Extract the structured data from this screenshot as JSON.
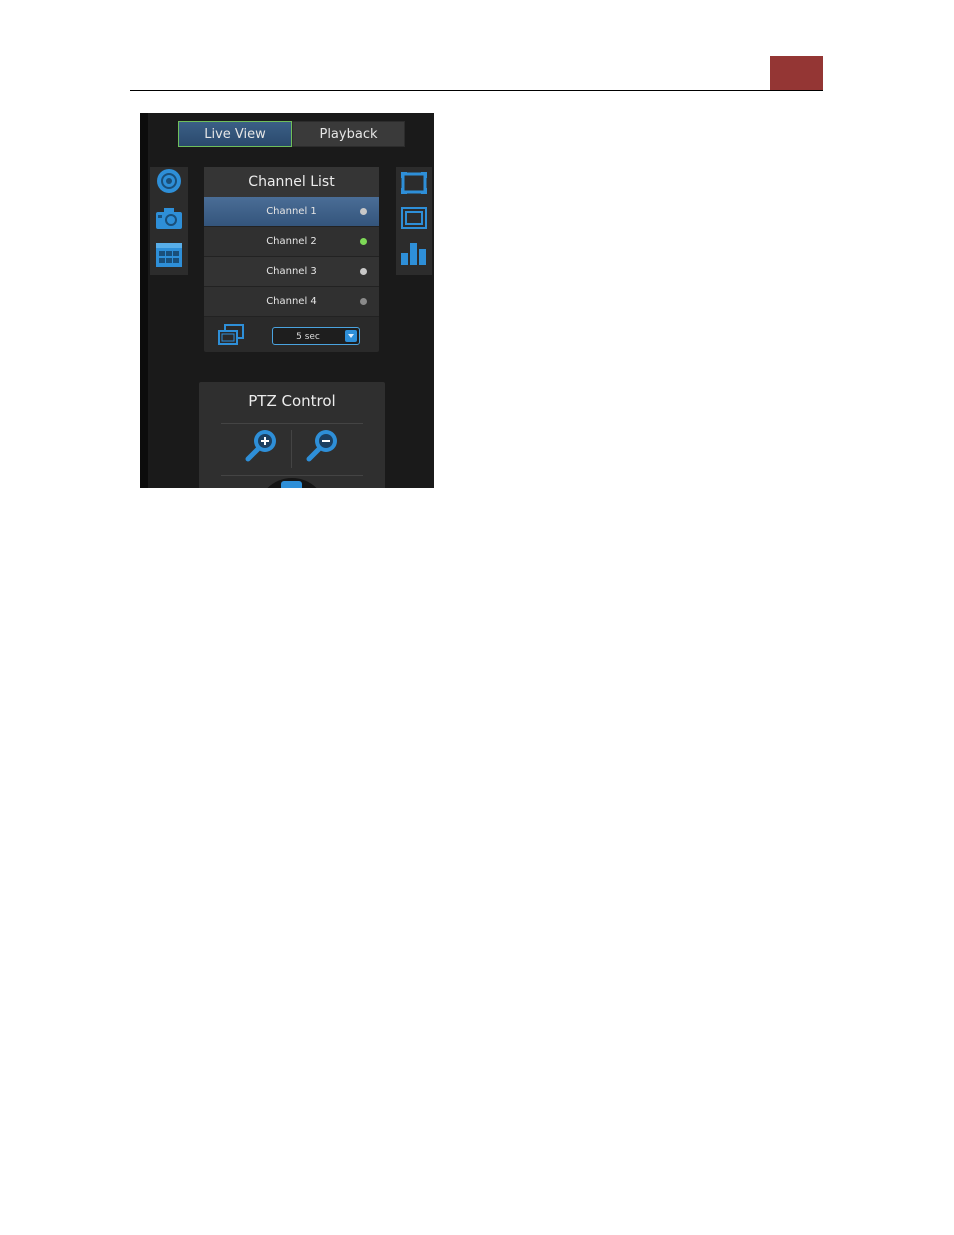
{
  "tabs": {
    "live_view": "Live View",
    "playback": "Playback"
  },
  "left_tools": [
    "record-icon",
    "snapshot-icon",
    "layout-grid-icon"
  ],
  "right_tools": [
    "fullscreen-icon",
    "aspect-ratio-icon",
    "statistics-icon"
  ],
  "channel_list": {
    "title": "Channel List",
    "channels": [
      {
        "label": "Channel 1",
        "status_color": "#c8c8c8",
        "selected": true
      },
      {
        "label": "Channel 2",
        "status_color": "#7ed957",
        "selected": false
      },
      {
        "label": "Channel 3",
        "status_color": "#c8c8c8",
        "selected": false
      },
      {
        "label": "Channel 4",
        "status_color": "#8a8a8a",
        "selected": false
      }
    ],
    "sequence_interval": "5 sec"
  },
  "ptz": {
    "title": "PTZ Control"
  },
  "colors": {
    "accent": "#2e8fd8",
    "active_tab_border": "#6fbf5a",
    "header_block": "#943634"
  }
}
